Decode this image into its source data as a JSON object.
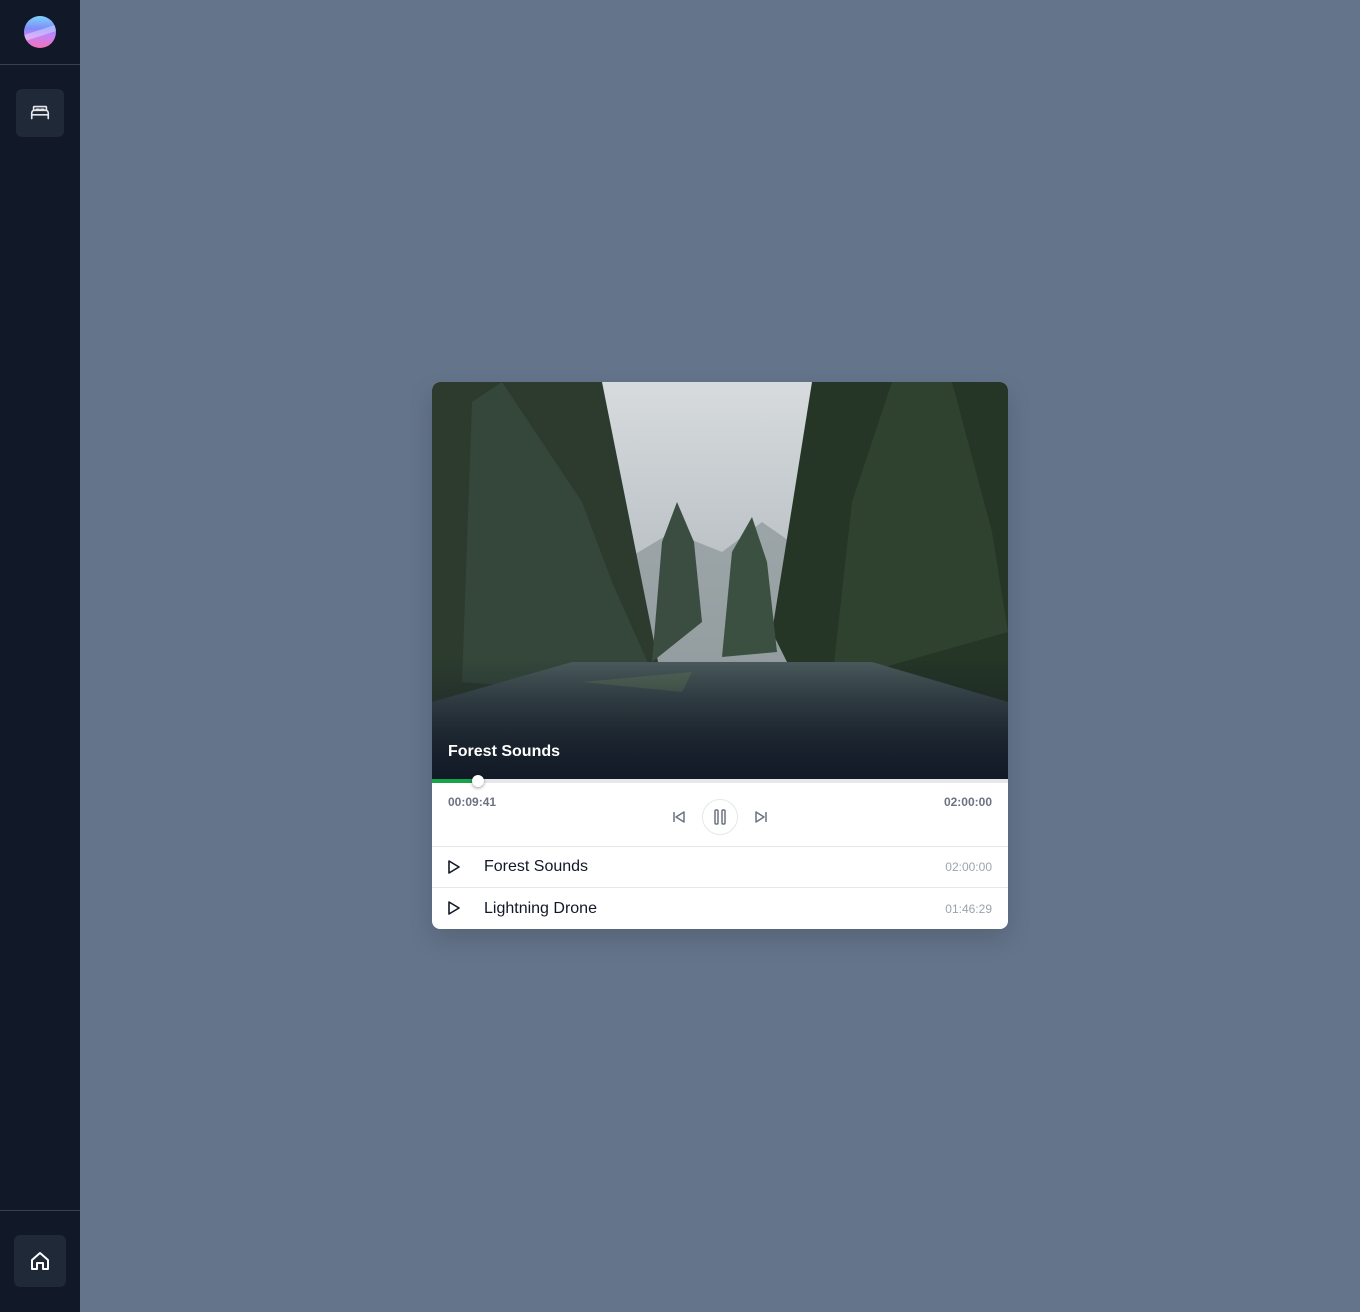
{
  "app": {
    "logo": "gradient-orb-logo",
    "colors": {
      "sidebar_bg": "#111827",
      "page_bg": "#64748b",
      "progress_accent": "#16a34a"
    }
  },
  "sidebar": {
    "items": [
      {
        "icon": "bed-icon",
        "active": true
      }
    ],
    "footer": {
      "icon": "home-icon"
    }
  },
  "player": {
    "now_playing": {
      "title": "Forest Sounds",
      "artwork": "misty-forest-lake-image"
    },
    "elapsed": "00:09:41",
    "total": "02:00:00",
    "progress": 0.0806,
    "controls": {
      "previous": "skip-back-icon",
      "pause": "pause-icon",
      "next": "skip-forward-icon"
    }
  },
  "playlist": [
    {
      "title": "Forest Sounds",
      "duration": "02:00:00"
    },
    {
      "title": "Lightning Drone",
      "duration": "01:46:29"
    }
  ]
}
